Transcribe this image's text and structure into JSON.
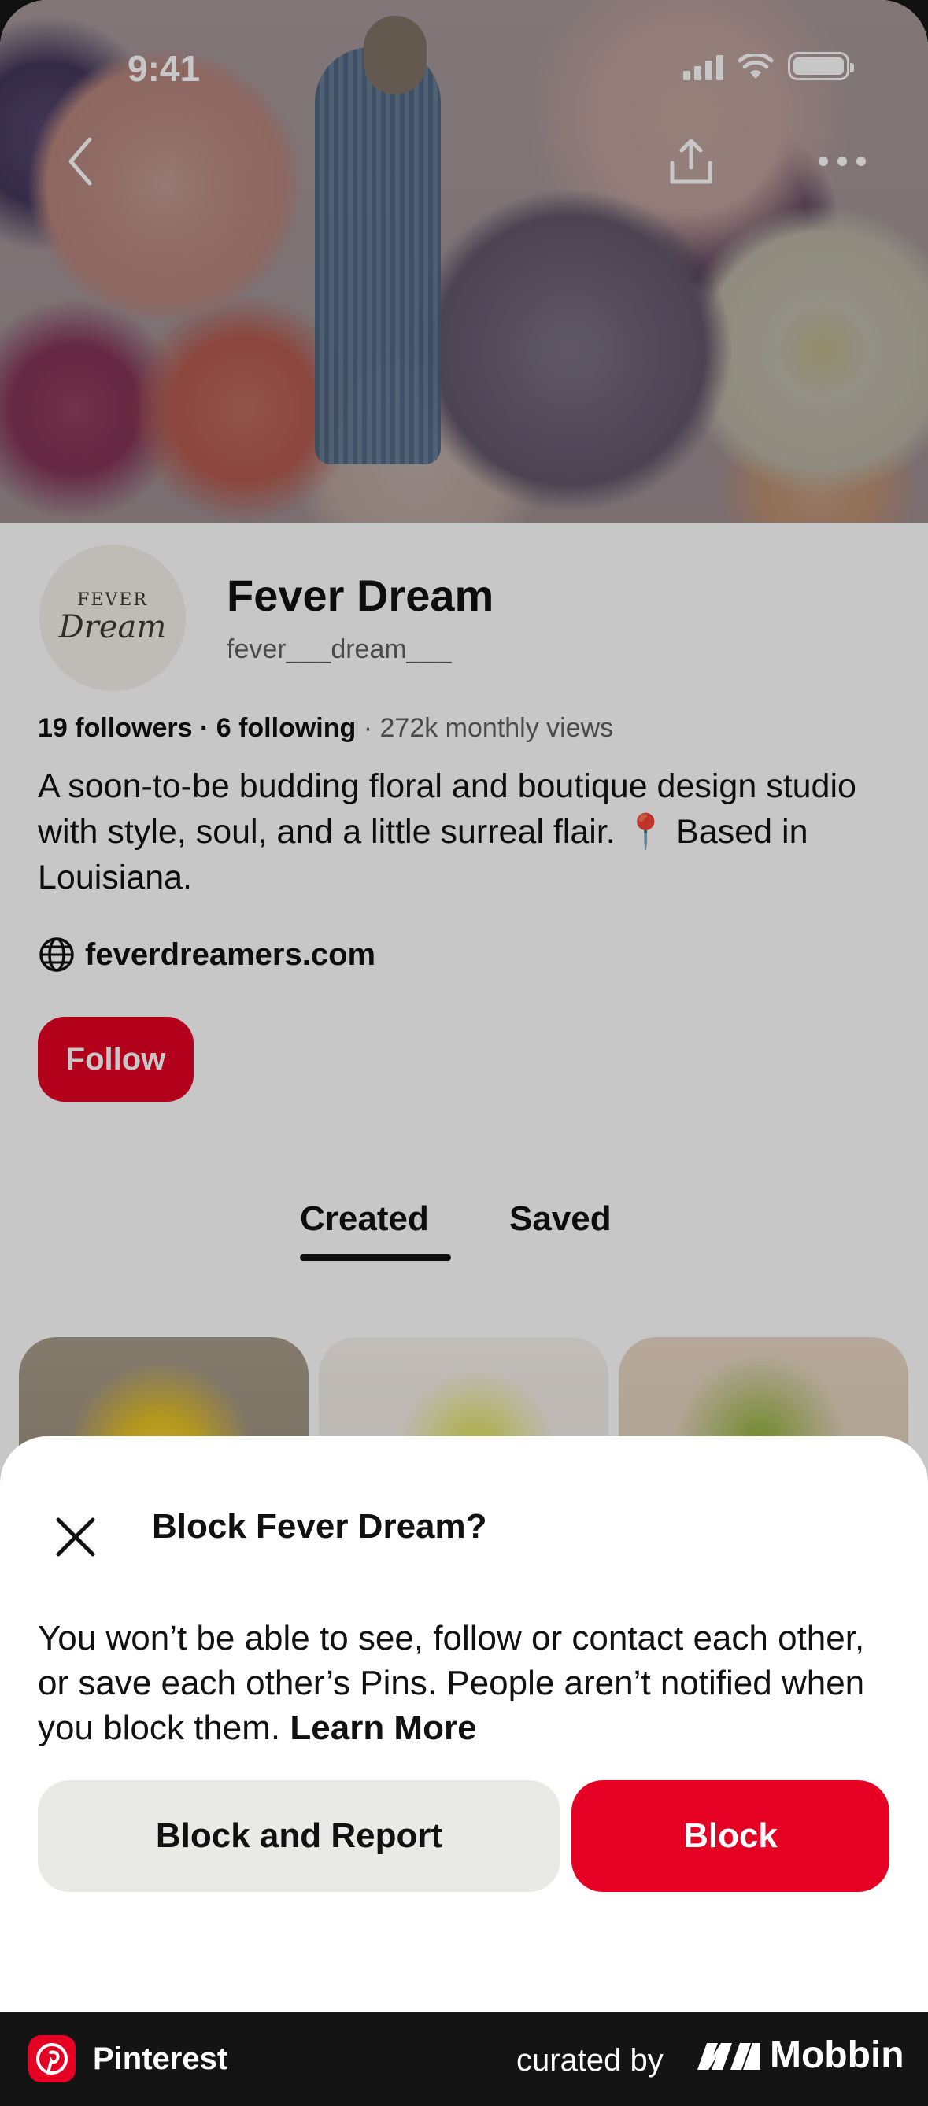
{
  "status_bar": {
    "time": "9:41"
  },
  "profile": {
    "name": "Fever Dream",
    "handle": "fever___dream___",
    "avatar_logo_top": "FEVER",
    "avatar_logo_bottom": "Dream",
    "followers": "19 followers",
    "separator": " · ",
    "following": "6 following",
    "monthly_views": "272k monthly views",
    "bio": "A soon-to-be budding floral and boutique design studio with style, soul, and a little surreal flair. 📍 Based in Louisiana.",
    "website": "feverdreamers.com",
    "follow_label": "Follow"
  },
  "tabs": [
    {
      "label": "Created",
      "active": true
    },
    {
      "label": "Saved",
      "active": false
    }
  ],
  "block_sheet": {
    "title": "Block Fever Dream?",
    "body": "You won’t be able to see, follow or contact each other, or save each other’s Pins. People aren’t notified when you block them.",
    "learn_more": "Learn More",
    "block_and_report_label": "Block and Report",
    "block_label": "Block"
  },
  "footer": {
    "app_name": "Pinterest",
    "curated_by": "curated by",
    "brand": "Mobbin"
  },
  "colors": {
    "accent_red": "#e60023",
    "secondary_button": "#e9e9e5",
    "footer_bg": "#141414"
  }
}
